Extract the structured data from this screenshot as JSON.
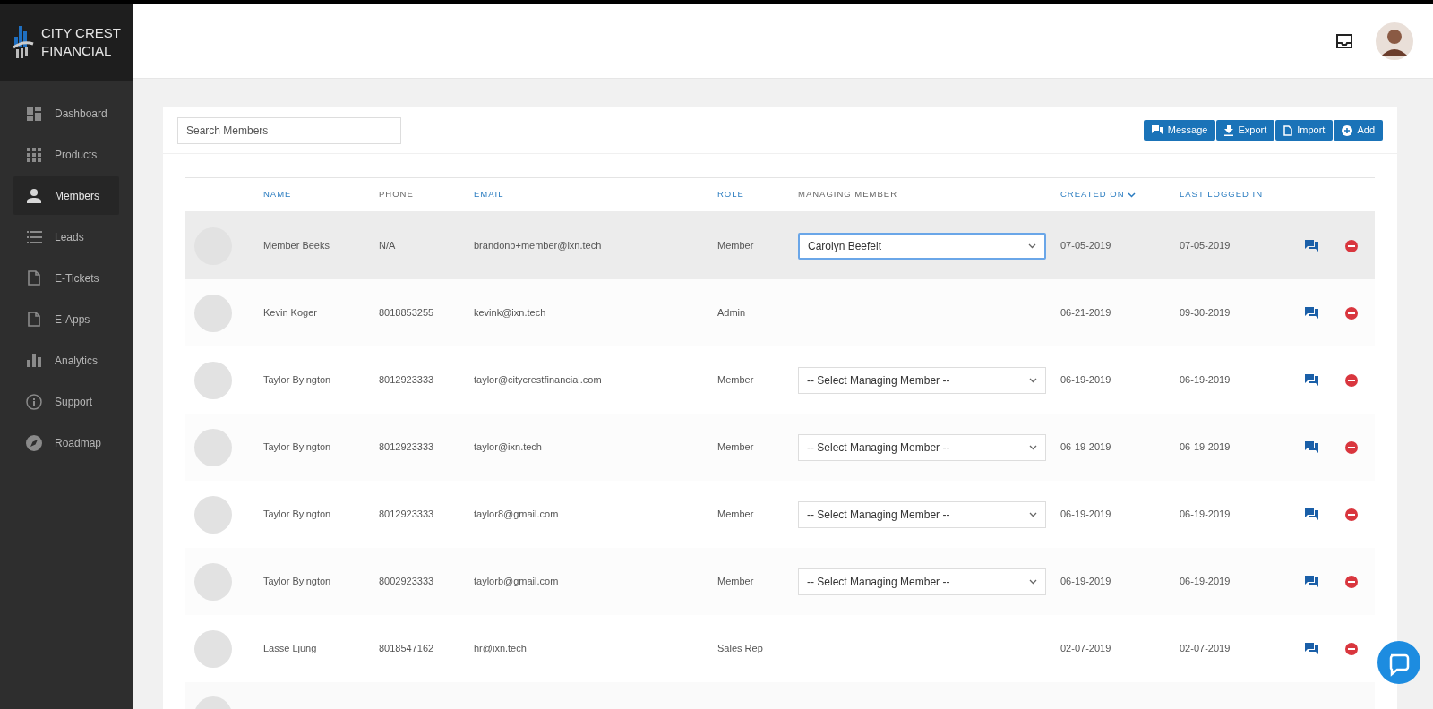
{
  "brand": {
    "line1": "CITY CREST",
    "line2": "FINANCIAL"
  },
  "sidebar": {
    "items": [
      {
        "label": "Dashboard",
        "selected": false
      },
      {
        "label": "Products",
        "selected": false
      },
      {
        "label": "Members",
        "selected": true
      },
      {
        "label": "Leads",
        "selected": false
      },
      {
        "label": "E-Tickets",
        "selected": false
      },
      {
        "label": "E-Apps",
        "selected": false
      },
      {
        "label": "Analytics",
        "selected": false
      },
      {
        "label": "Support",
        "selected": false
      },
      {
        "label": "Roadmap",
        "selected": false
      }
    ]
  },
  "search": {
    "placeholder": "Search Members"
  },
  "actions": [
    {
      "label": "Message"
    },
    {
      "label": "Export"
    },
    {
      "label": "Import"
    },
    {
      "label": "Add"
    }
  ],
  "table": {
    "columns": [
      {
        "label": "NAME",
        "sortable": true,
        "sorted": false
      },
      {
        "label": "PHONE",
        "sortable": false,
        "sorted": false
      },
      {
        "label": "EMAIL",
        "sortable": true,
        "sorted": false
      },
      {
        "label": "ROLE",
        "sortable": true,
        "sorted": false
      },
      {
        "label": "MANAGING MEMBER",
        "sortable": false,
        "sorted": false
      },
      {
        "label": "CREATED ON",
        "sortable": true,
        "sorted": true
      },
      {
        "label": "LAST LOGGED IN",
        "sortable": true,
        "sorted": false
      }
    ],
    "rows": [
      {
        "selected": true,
        "name": "Member Beeks",
        "phone": "N/A",
        "email": "brandonb+member@ixn.tech",
        "role": "Member",
        "managing_member": {
          "value": "Carolyn Beefelt",
          "focused": true
        },
        "created_on": "07-05-2019",
        "last_logged_in": "07-05-2019"
      },
      {
        "selected": false,
        "name": "Kevin Koger",
        "phone": "8018853255",
        "email": "kevink@ixn.tech",
        "role": "Admin",
        "created_on": "06-21-2019",
        "last_logged_in": "09-30-2019"
      },
      {
        "selected": false,
        "name": "Taylor Byington",
        "phone": "8012923333",
        "email": "taylor@citycrestfinancial.com",
        "role": "Member",
        "managing_member": {
          "value": "-- Select Managing Member --",
          "focused": false
        },
        "created_on": "06-19-2019",
        "last_logged_in": "06-19-2019"
      },
      {
        "selected": false,
        "name": "Taylor Byington",
        "phone": "8012923333",
        "email": "taylor@ixn.tech",
        "role": "Member",
        "managing_member": {
          "value": "-- Select Managing Member --",
          "focused": false
        },
        "created_on": "06-19-2019",
        "last_logged_in": "06-19-2019"
      },
      {
        "selected": false,
        "name": "Taylor Byington",
        "phone": "8012923333",
        "email": "taylor8@gmail.com",
        "role": "Member",
        "managing_member": {
          "value": "-- Select Managing Member --",
          "focused": false
        },
        "created_on": "06-19-2019",
        "last_logged_in": "06-19-2019"
      },
      {
        "selected": false,
        "name": "Taylor Byington",
        "phone": "8002923333",
        "email": "taylorb@gmail.com",
        "role": "Member",
        "managing_member": {
          "value": "-- Select Managing Member --",
          "focused": false
        },
        "created_on": "06-19-2019",
        "last_logged_in": "06-19-2019"
      },
      {
        "selected": false,
        "name": "Lasse Ljung",
        "phone": "8018547162",
        "email": "hr@ixn.tech",
        "role": "Sales Rep",
        "created_on": "02-07-2019",
        "last_logged_in": "02-07-2019"
      }
    ]
  }
}
